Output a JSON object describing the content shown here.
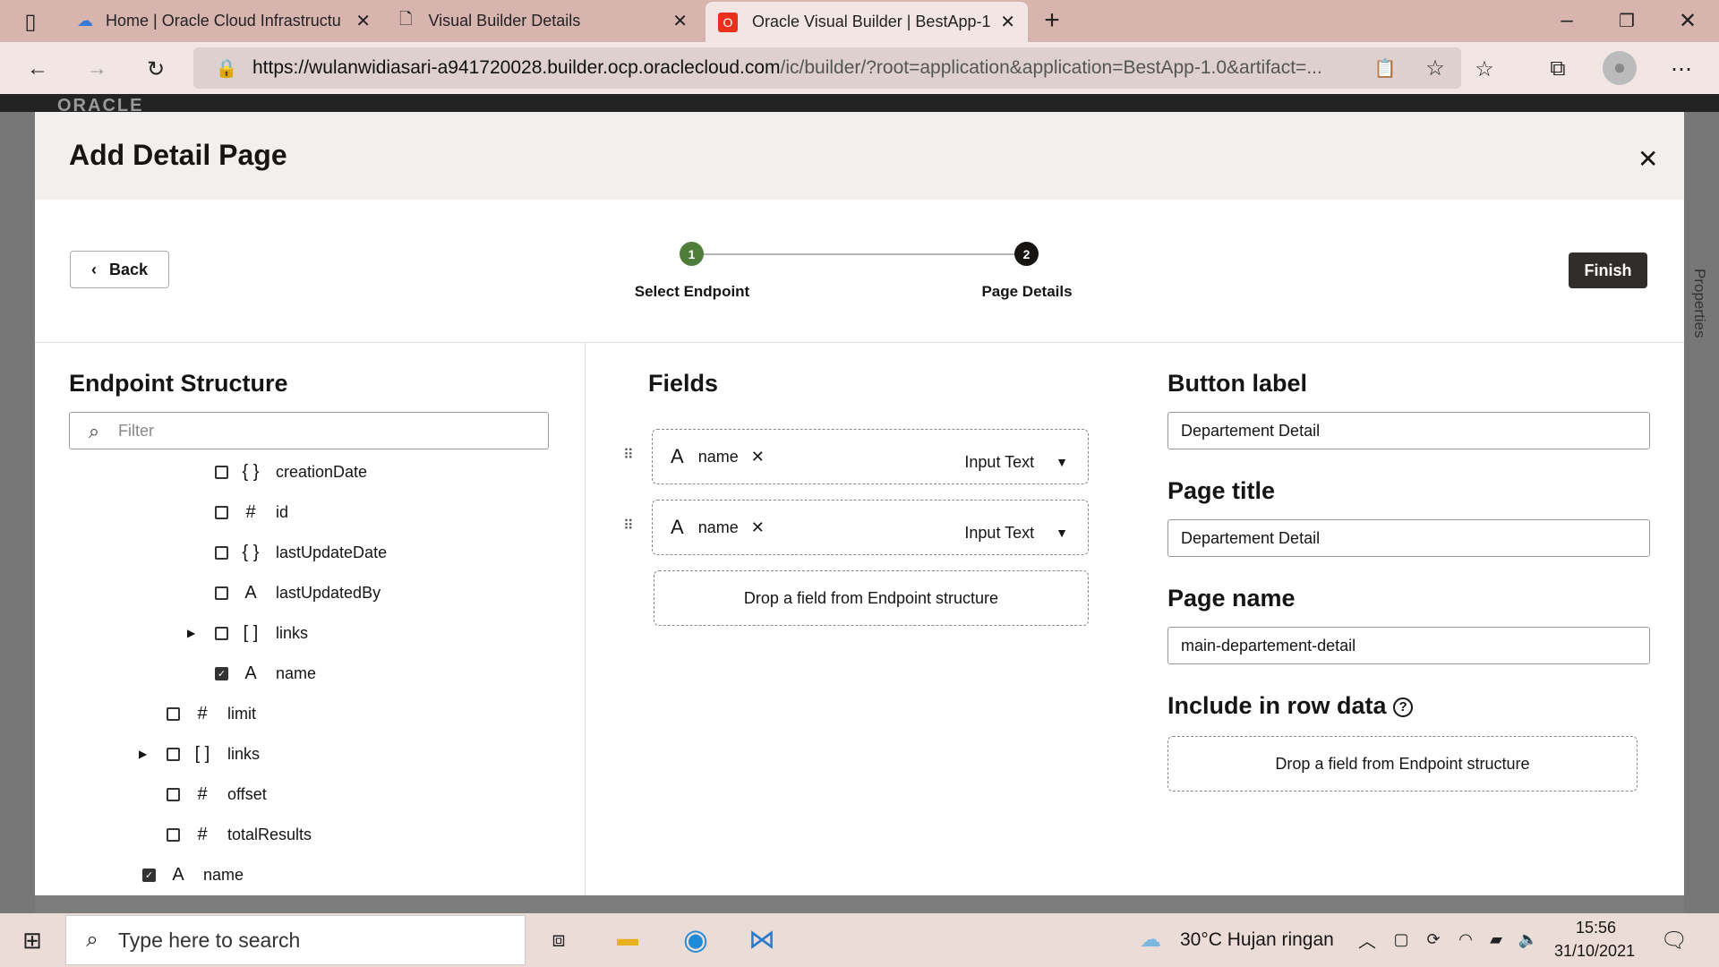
{
  "browser": {
    "tabs": [
      {
        "title": "Home | Oracle Cloud Infrastructu"
      },
      {
        "title": "Visual Builder Details"
      },
      {
        "title": "Oracle Visual Builder | BestApp-1"
      }
    ],
    "url_host": "https://wulanwidiasari-a941720028.builder.ocp.oraclecloud.com",
    "url_path": "/ic/builder/?root=application&application=BestApp-1.0&artifact=..."
  },
  "app": {
    "logo": "ORACLE",
    "side_panel": "Properties"
  },
  "modal": {
    "title": "Add Detail Page",
    "back_label": "Back",
    "finish_label": "Finish",
    "steps": [
      {
        "number": "1",
        "label": "Select Endpoint",
        "color": "#4f7d3a"
      },
      {
        "number": "2",
        "label": "Page Details",
        "color": "#161513"
      }
    ],
    "endpoint": {
      "title": "Endpoint Structure",
      "filter_placeholder": "Filter",
      "items": [
        {
          "icon": "{ }",
          "label": "creationDate",
          "checked": false
        },
        {
          "icon": "#",
          "label": "id",
          "checked": false
        },
        {
          "icon": "{ }",
          "label": "lastUpdateDate",
          "checked": false
        },
        {
          "icon": "A",
          "label": "lastUpdatedBy",
          "checked": false
        },
        {
          "icon": "[ ]",
          "label": "links",
          "checked": false,
          "expandable": true
        },
        {
          "icon": "A",
          "label": "name",
          "checked": true
        },
        {
          "icon": "#",
          "label": "limit",
          "checked": false
        },
        {
          "icon": "[ ]",
          "label": "links",
          "checked": false,
          "expandable": true
        },
        {
          "icon": "#",
          "label": "offset",
          "checked": false
        },
        {
          "icon": "#",
          "label": "totalResults",
          "checked": false
        },
        {
          "icon": "A",
          "label": "name",
          "checked": true
        }
      ]
    },
    "fields": {
      "title": "Fields",
      "items": [
        {
          "name": "name",
          "type": "Input Text"
        },
        {
          "name": "name",
          "type": "Input Text"
        }
      ],
      "drop_text": "Drop a field from Endpoint structure"
    },
    "settings": {
      "button_label_title": "Button label",
      "button_label_value": "Departement Detail",
      "page_title_title": "Page title",
      "page_title_value": "Departement Detail",
      "page_name_title": "Page name",
      "page_name_value": "main-departement-detail",
      "row_data_title": "Include in row data",
      "row_data_drop": "Drop a field from Endpoint structure"
    }
  },
  "taskbar": {
    "search_placeholder": "Type here to search",
    "weather": "30°C  Hujan ringan",
    "time": "15:56",
    "date": "31/10/2021"
  }
}
